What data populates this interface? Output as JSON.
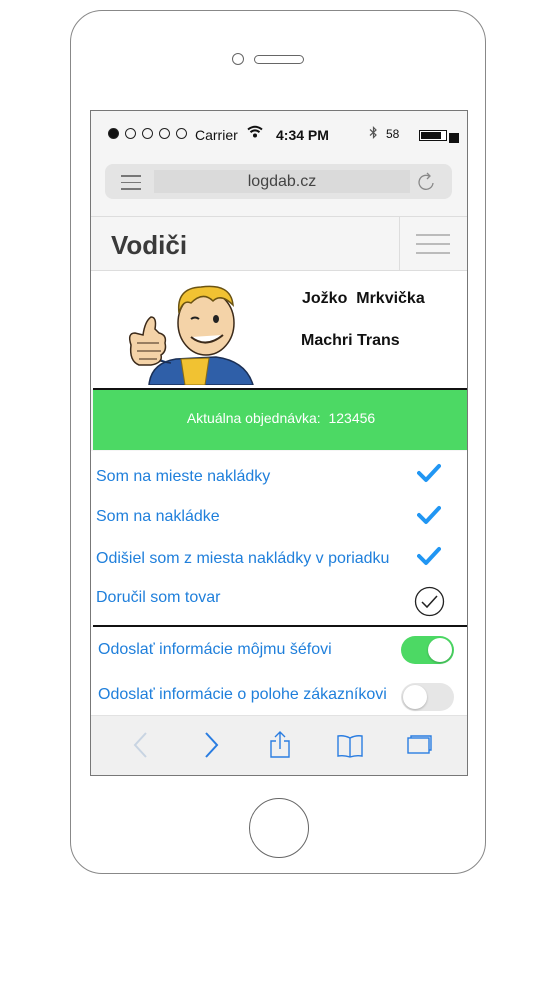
{
  "status_bar": {
    "carrier": "Carrier",
    "time": "4:34 PM",
    "bluetooth_icon": "bluetooth-icon",
    "battery_percent": "58",
    "battery_level": 0.85,
    "signal_dots_filled": 1,
    "signal_dots_total": 5
  },
  "browser": {
    "url": "logdab.cz",
    "menu_icon": "list-icon",
    "reload_icon": "reload-icon"
  },
  "app_header": {
    "title": "Vodiči",
    "menu_icon": "hamburger-icon"
  },
  "profile": {
    "name": "Jožko  Mrkvička",
    "company": "Machri Trans",
    "avatar": "cartoon-thumbs-up-avatar"
  },
  "order": {
    "label": "Aktuálna objednávka:  123456"
  },
  "tasks": [
    {
      "label": "Som na mieste nakládky",
      "done": true
    },
    {
      "label": "Som na nakládke",
      "done": true
    },
    {
      "label": "Odišiel som z miesta nakládky v poriadku",
      "done": true
    },
    {
      "label": "Doručil som tovar",
      "done": false
    }
  ],
  "settings": [
    {
      "label": "Odoslať informácie môjmu šéfovi",
      "enabled": true
    },
    {
      "label": "Odoslať informácie o polohe zákazníkovi",
      "enabled": false
    }
  ],
  "toolbar": {
    "icons": [
      "back-icon",
      "forward-icon",
      "share-icon",
      "bookmarks-icon",
      "tabs-icon"
    ]
  },
  "colors": {
    "accent_blue": "#1f7fdb",
    "check_blue": "#2196f3",
    "green": "#4cd964",
    "header_text": "#3a3a3a"
  }
}
